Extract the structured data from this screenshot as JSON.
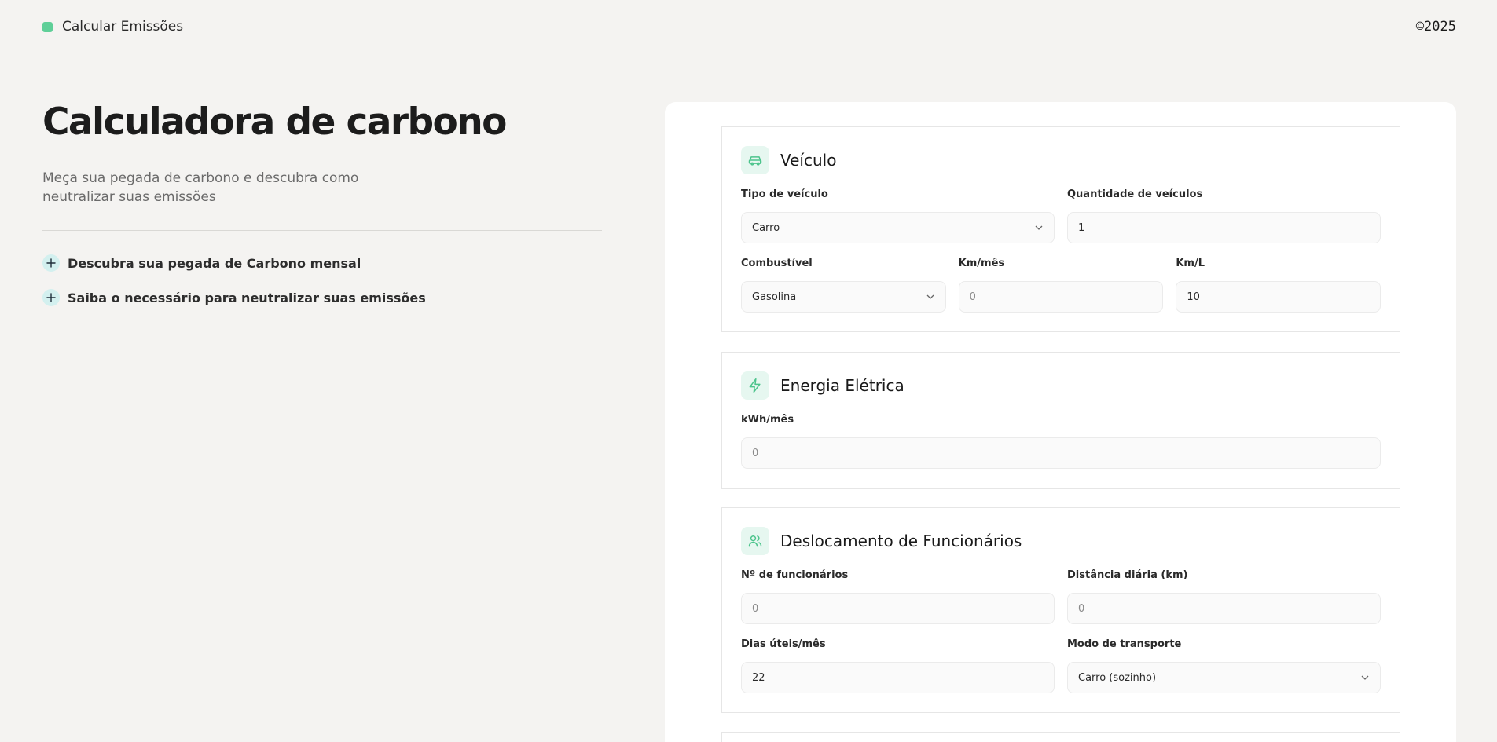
{
  "header": {
    "brand_label": "Calcular Emissões",
    "copyright": "©2025"
  },
  "hero": {
    "title": "Calculadora de carbono",
    "subtitle": "Meça sua pegada de carbono e descubra como neutralizar suas emissões",
    "features": [
      {
        "label": "Descubra sua pegada de Carbono mensal"
      },
      {
        "label": "Saiba o necessário para neutralizar suas emissões"
      }
    ]
  },
  "sections": {
    "vehicle": {
      "title": "Veículo",
      "icon": "car-icon",
      "type_label": "Tipo de veículo",
      "type_value": "Carro",
      "qty_label": "Quantidade de veículos",
      "qty_value": "1",
      "fuel_label": "Combustível",
      "fuel_value": "Gasolina",
      "km_month_label": "Km/mês",
      "km_month_value": "0",
      "km_l_label": "Km/L",
      "km_l_value": "10"
    },
    "energy": {
      "title": "Energia Elétrica",
      "icon": "lightning-icon",
      "kwh_label": "kWh/mês",
      "kwh_value": "0"
    },
    "commute": {
      "title": "Deslocamento de Funcionários",
      "icon": "users-icon",
      "employees_label": "Nº de funcionários",
      "employees_value": "0",
      "distance_label": "Distância diária (km)",
      "distance_value": "0",
      "days_label": "Dias úteis/mês",
      "days_value": "22",
      "mode_label": "Modo de transporte",
      "mode_value": "Carro (sozinho)"
    }
  },
  "colors": {
    "background": "#f4f3f1",
    "accent": "#5fcf98",
    "icon_bg": "#e6f7f0",
    "plus_bg": "#d3f0ef"
  }
}
